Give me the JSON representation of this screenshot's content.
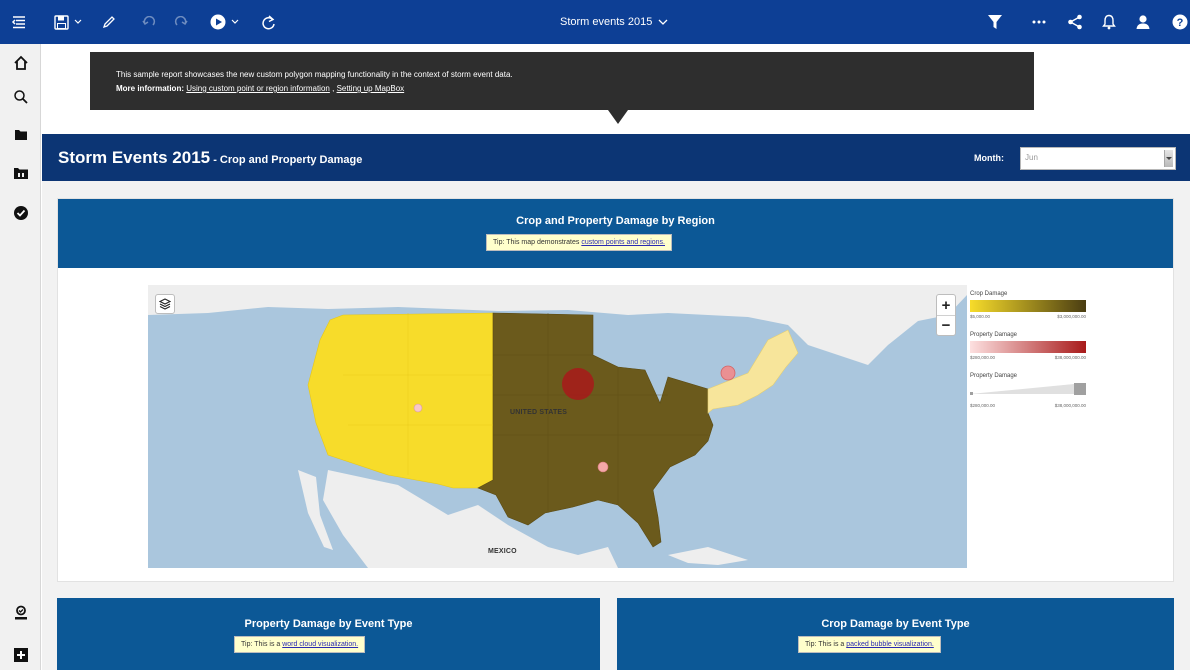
{
  "toolbar": {
    "report_title": "Storm events 2015",
    "icons": [
      "hamburger-icon",
      "save-icon",
      "chevron-down-icon",
      "pencil-icon",
      "undo-icon",
      "redo-icon",
      "play-icon",
      "refresh-icon",
      "filter-icon",
      "more-icon",
      "share-icon",
      "bell-icon",
      "user-icon",
      "help-icon"
    ]
  },
  "sidebar": {
    "icons": [
      "home-icon",
      "search-icon",
      "folder-icon",
      "team-folder-icon",
      "check-icon",
      "profile-icon",
      "new-icon"
    ]
  },
  "info_tooltip": {
    "line1": "This sample report showcases the new custom polygon mapping functionality in the context of storm event data.",
    "more_label": "More information:",
    "link1": "Using custom point or region information",
    "separator": ",",
    "link2": "Setting up MapBox"
  },
  "banner": {
    "title": "Storm Events 2015",
    "subtitle": " - Crop and Property Damage",
    "month_label": "Month:",
    "month_value": "Jun"
  },
  "map_card": {
    "title": "Crop and Property Damage by Region",
    "tip_prefix": "Tip: This map demonstrates ",
    "tip_link": "custom points and regions.",
    "label_us": "UNITED STATES",
    "label_mexico": "MEXICO",
    "zoom_in": "+",
    "zoom_out": "−"
  },
  "legend": {
    "crop": {
      "title": "Crop Damage",
      "min": "$5,000.00",
      "max": "$3,000,000.00",
      "color_low": "#f7dc2a",
      "color_high": "#4a3d12"
    },
    "property_color": {
      "title": "Property Damage",
      "min": "$280,000.00",
      "max": "$38,000,000.00",
      "color_low": "#fde0e0",
      "color_high": "#a81a1a"
    },
    "property_size": {
      "title": "Property Damage",
      "min": "$280,000.00",
      "max": "$38,000,000.00"
    }
  },
  "cards": [
    {
      "title": "Property Damage by Event Type",
      "tip_prefix": "Tip: This is a ",
      "tip_link": "word cloud visualization."
    },
    {
      "title": "Crop Damage by Event Type",
      "tip_prefix": "Tip: This is a ",
      "tip_link": "packed bubble visualization."
    }
  ],
  "colors": {
    "topbar": "#0d3f95",
    "banner": "#0c3574",
    "card_header": "#0c5896",
    "region_west": "#f7dc2a",
    "region_central_east": "#6b5a1c",
    "region_northeast": "#f7e59b",
    "water": "#aac6dd",
    "land": "#eeeeee"
  }
}
